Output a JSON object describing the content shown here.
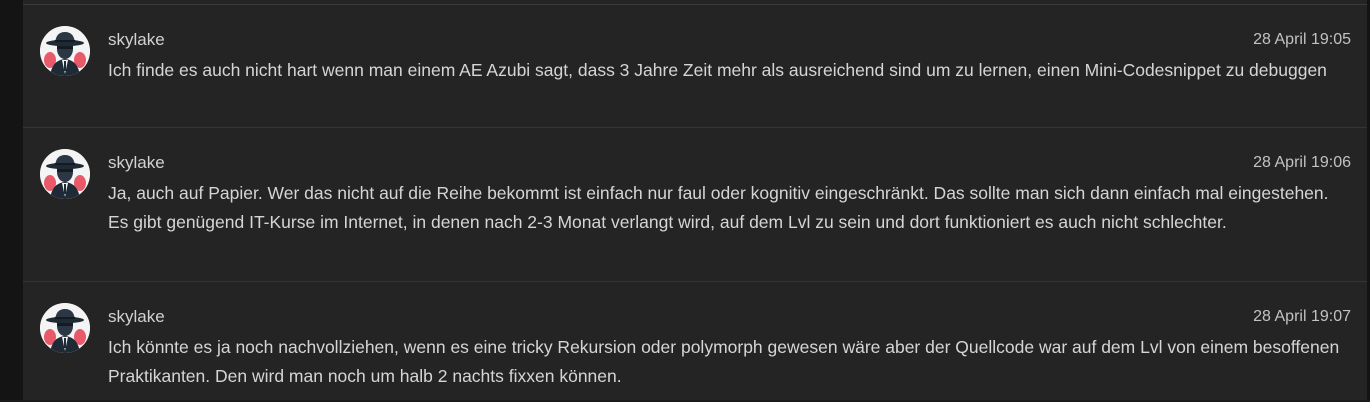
{
  "messages": [
    {
      "username": "skylake",
      "timestamp": "28 April 19:05",
      "text": "Ich finde es auch nicht hart wenn man einem AE Azubi sagt, dass 3 Jahre Zeit mehr als ausreichend sind um zu lernen, einen Mini-Codesnippet zu debuggen",
      "avatar_icon": "spy-hat-icon"
    },
    {
      "username": "skylake",
      "timestamp": "28 April 19:06",
      "text": "Ja, auch auf Papier. Wer das nicht auf die Reihe bekommt ist einfach nur faul oder kognitiv eingeschränkt. Das sollte man sich dann einfach mal eingestehen. Es gibt genügend IT-Kurse im Internet, in denen nach 2-3 Monat verlangt wird, auf dem Lvl zu sein und dort funktioniert es auch nicht schlechter.",
      "avatar_icon": "spy-hat-icon"
    },
    {
      "username": "skylake",
      "timestamp": "28 April 19:07",
      "text": "Ich könnte es ja noch nachvollziehen, wenn es eine tricky Rekursion oder polymorph gewesen wäre aber der Quellcode war auf dem Lvl von einem besoffenen Praktikanten. Den wird man noch um halb 2 nachts fixxen können.",
      "avatar_icon": "spy-hat-icon"
    }
  ],
  "colors": {
    "background": "#242424",
    "text": "#d5d5d5",
    "divider": "#353535",
    "avatar_accent": "#e85a6a"
  }
}
